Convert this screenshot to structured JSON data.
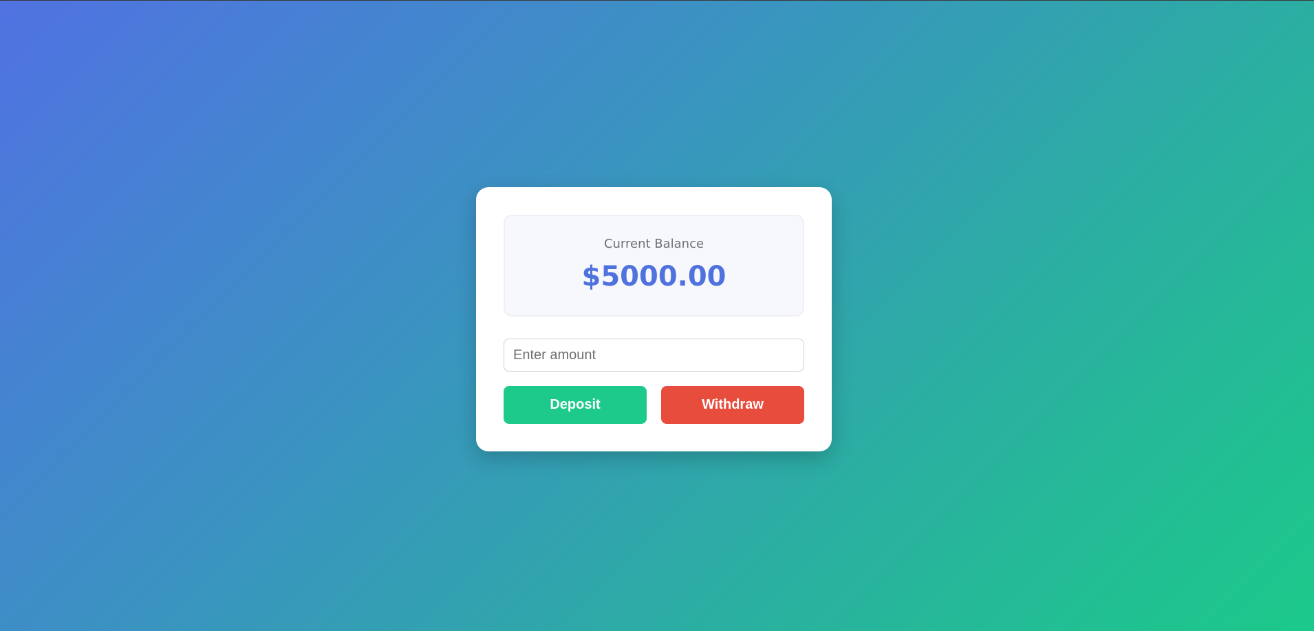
{
  "balance": {
    "label": "Current Balance",
    "amount": "$5000.00"
  },
  "amount_input": {
    "placeholder": "Enter amount",
    "value": ""
  },
  "buttons": {
    "deposit": "Deposit",
    "withdraw": "Withdraw"
  },
  "colors": {
    "accent": "#4f72df",
    "deposit": "#1dca8b",
    "withdraw": "#e74c3c",
    "gradient_start": "#5072e2",
    "gradient_end": "#1cc98a"
  }
}
